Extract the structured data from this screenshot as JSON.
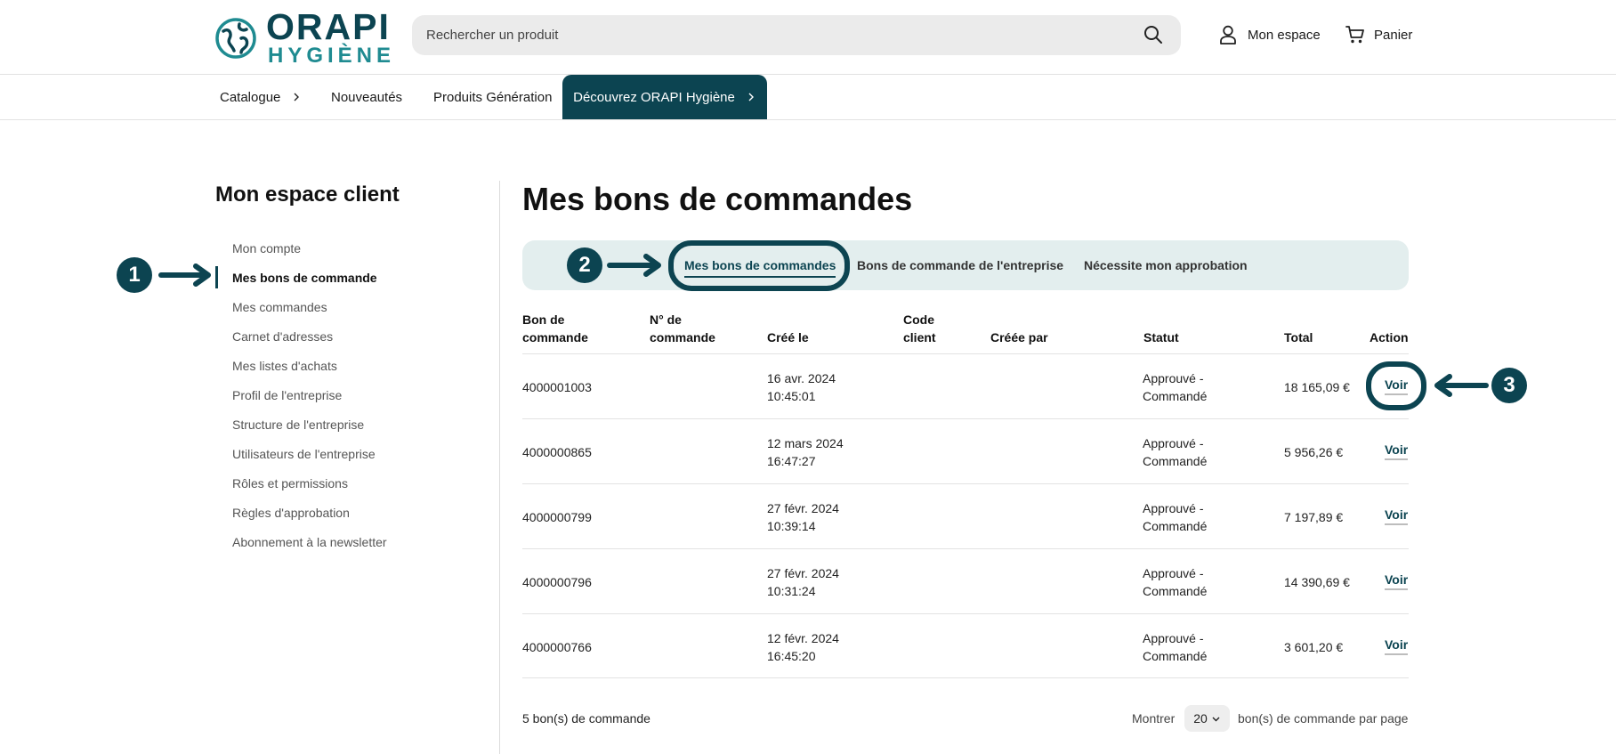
{
  "header": {
    "logo_line1": "ORAPI",
    "logo_line2": "HYGIÈNE",
    "search_placeholder": "Rechercher un produit",
    "account_label": "Mon espace",
    "cart_label": "Panier"
  },
  "nav": {
    "items": [
      {
        "label": "Catalogue"
      },
      {
        "label": "Nouveautés"
      },
      {
        "label": "Produits Génération"
      }
    ],
    "highlight": "Découvrez ORAPI Hygiène"
  },
  "sidebar": {
    "title": "Mon espace client",
    "items": [
      {
        "label": "Mon compte"
      },
      {
        "label": "Mes bons de commande"
      },
      {
        "label": "Mes commandes"
      },
      {
        "label": "Carnet d'adresses"
      },
      {
        "label": "Mes listes d'achats"
      },
      {
        "label": "Profil de l'entreprise"
      },
      {
        "label": "Structure de l'entreprise"
      },
      {
        "label": "Utilisateurs de l'entreprise"
      },
      {
        "label": "Rôles et permissions"
      },
      {
        "label": "Règles d'approbation"
      },
      {
        "label": "Abonnement à la newsletter"
      }
    ]
  },
  "main": {
    "title": "Mes bons de commandes",
    "tabs": [
      {
        "label": "Mes bons de commandes"
      },
      {
        "label": "Bons de commande de l'entreprise"
      },
      {
        "label": "Nécessite mon approbation"
      }
    ],
    "columns": {
      "po_line1": "Bon de",
      "po_line2": "commande",
      "order_line1": "N° de",
      "order_line2": "commande",
      "created": "Créé le",
      "client_line1": "Code",
      "client_line2": "client",
      "created_by": "Créée par",
      "status": "Statut",
      "total": "Total",
      "action": "Action"
    },
    "rows": [
      {
        "po": "4000001003",
        "date": "16 avr. 2024",
        "time": "10:45:01",
        "status1": "Approuvé -",
        "status2": "Commandé",
        "total": "18 165,09 €",
        "action": "Voir"
      },
      {
        "po": "4000000865",
        "date": "12 mars 2024",
        "time": "16:47:27",
        "status1": "Approuvé -",
        "status2": "Commandé",
        "total": "5 956,26 €",
        "action": "Voir"
      },
      {
        "po": "4000000799",
        "date": "27 févr. 2024",
        "time": "10:39:14",
        "status1": "Approuvé -",
        "status2": "Commandé",
        "total": "7 197,89 €",
        "action": "Voir"
      },
      {
        "po": "4000000796",
        "date": "27 févr. 2024",
        "time": "10:31:24",
        "status1": "Approuvé -",
        "status2": "Commandé",
        "total": "14 390,69 €",
        "action": "Voir"
      },
      {
        "po": "4000000766",
        "date": "12 févr. 2024",
        "time": "16:45:20",
        "status1": "Approuvé -",
        "status2": "Commandé",
        "total": "3 601,20 €",
        "action": "Voir"
      }
    ],
    "footer": {
      "count": "5 bon(s) de commande",
      "show_label": "Montrer",
      "per_page": "20",
      "per_page_suffix": "bon(s) de commande par page"
    }
  },
  "annotations": {
    "badge1": "1",
    "badge2": "2",
    "badge3": "3"
  },
  "colors": {
    "brand_dark": "#0c4451",
    "brand_teal": "#1f8b91",
    "tabbar_bg": "#e3eeee"
  }
}
